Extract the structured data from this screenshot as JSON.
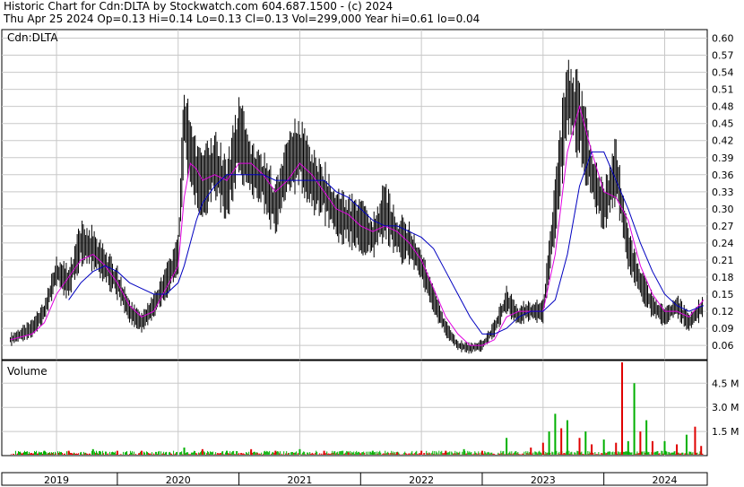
{
  "header": {
    "line1": "Historic Chart for Cdn:DLTA by Stockwatch.com 604.687.1500 - (c) 2024",
    "line2": "Thu Apr 25 2024   Op=0.13  Hi=0.14  Lo=0.13  Cl=0.13  Vol=299,000  Year hi=0.61  lo=0.04"
  },
  "chart_data": [
    {
      "type": "line",
      "title": "Cdn:DLTA",
      "x_labels": [
        "2019",
        "2020",
        "2021",
        "2022",
        "2023",
        "2024"
      ],
      "yticks": [
        "0.06",
        "0.09",
        "0.12",
        "0.15",
        "0.18",
        "0.21",
        "0.24",
        "0.27",
        "0.30",
        "0.33",
        "0.36",
        "0.39",
        "0.42",
        "0.45",
        "0.48",
        "0.51",
        "0.54",
        "0.57",
        "0.60"
      ],
      "ylim": [
        0.035,
        0.615
      ],
      "series": [
        {
          "kind": "price-hilo-bars",
          "color": "#000000",
          "x": [
            2018.62,
            2018.8,
            2018.9,
            2019.0,
            2019.1,
            2019.2,
            2019.3,
            2019.4,
            2019.5,
            2019.6,
            2019.7,
            2019.8,
            2019.9,
            2020.0,
            2020.05,
            2020.1,
            2020.15,
            2020.2,
            2020.3,
            2020.4,
            2020.5,
            2020.6,
            2020.7,
            2020.8,
            2020.9,
            2021.0,
            2021.1,
            2021.2,
            2021.3,
            2021.4,
            2021.5,
            2021.6,
            2021.7,
            2021.8,
            2021.9,
            2022.0,
            2022.1,
            2022.2,
            2022.3,
            2022.4,
            2022.5,
            2022.6,
            2022.7,
            2022.8,
            2022.85,
            2022.9,
            2023.0,
            2023.1,
            2023.2,
            2023.3,
            2023.4,
            2023.5,
            2023.6,
            2023.7,
            2023.8,
            2023.9,
            2024.0,
            2024.1,
            2024.2,
            2024.32
          ],
          "values": [
            0.07,
            0.09,
            0.12,
            0.19,
            0.17,
            0.24,
            0.23,
            0.2,
            0.17,
            0.12,
            0.1,
            0.13,
            0.17,
            0.22,
            0.46,
            0.4,
            0.36,
            0.34,
            0.38,
            0.33,
            0.43,
            0.37,
            0.35,
            0.3,
            0.38,
            0.4,
            0.35,
            0.33,
            0.29,
            0.28,
            0.27,
            0.25,
            0.3,
            0.25,
            0.24,
            0.2,
            0.14,
            0.09,
            0.06,
            0.055,
            0.06,
            0.09,
            0.14,
            0.11,
            0.12,
            0.12,
            0.12,
            0.3,
            0.5,
            0.46,
            0.36,
            0.3,
            0.37,
            0.23,
            0.17,
            0.13,
            0.11,
            0.13,
            0.1,
            0.13
          ]
        },
        {
          "kind": "moving-average-short",
          "color": "#e000e0",
          "x": [
            2018.62,
            2018.8,
            2018.9,
            2019.0,
            2019.1,
            2019.2,
            2019.3,
            2019.4,
            2019.5,
            2019.6,
            2019.7,
            2019.8,
            2019.9,
            2020.0,
            2020.05,
            2020.1,
            2020.15,
            2020.2,
            2020.3,
            2020.4,
            2020.5,
            2020.6,
            2020.7,
            2020.8,
            2020.9,
            2021.0,
            2021.1,
            2021.2,
            2021.3,
            2021.4,
            2021.5,
            2021.6,
            2021.7,
            2021.8,
            2021.9,
            2022.0,
            2022.1,
            2022.2,
            2022.3,
            2022.4,
            2022.5,
            2022.6,
            2022.7,
            2022.8,
            2022.85,
            2022.9,
            2023.0,
            2023.1,
            2023.2,
            2023.3,
            2023.4,
            2023.5,
            2023.6,
            2023.7,
            2023.8,
            2023.9,
            2024.0,
            2024.1,
            2024.2,
            2024.32
          ],
          "values": [
            0.07,
            0.08,
            0.1,
            0.15,
            0.18,
            0.21,
            0.22,
            0.2,
            0.17,
            0.13,
            0.11,
            0.12,
            0.16,
            0.2,
            0.32,
            0.38,
            0.37,
            0.35,
            0.36,
            0.35,
            0.38,
            0.38,
            0.36,
            0.33,
            0.35,
            0.38,
            0.36,
            0.33,
            0.3,
            0.29,
            0.27,
            0.26,
            0.27,
            0.26,
            0.24,
            0.21,
            0.16,
            0.11,
            0.08,
            0.06,
            0.06,
            0.07,
            0.11,
            0.12,
            0.12,
            0.12,
            0.12,
            0.22,
            0.4,
            0.48,
            0.4,
            0.33,
            0.32,
            0.28,
            0.2,
            0.15,
            0.12,
            0.12,
            0.11,
            0.14
          ]
        },
        {
          "kind": "moving-average-long",
          "color": "#0000c0",
          "x": [
            2018.62,
            2018.8,
            2018.9,
            2019.0,
            2019.1,
            2019.2,
            2019.3,
            2019.4,
            2019.5,
            2019.6,
            2019.7,
            2019.8,
            2019.9,
            2020.0,
            2020.05,
            2020.1,
            2020.15,
            2020.2,
            2020.3,
            2020.4,
            2020.5,
            2020.6,
            2020.7,
            2020.8,
            2020.9,
            2021.0,
            2021.1,
            2021.2,
            2021.3,
            2021.4,
            2021.5,
            2021.6,
            2021.7,
            2021.8,
            2021.9,
            2022.0,
            2022.1,
            2022.2,
            2022.3,
            2022.4,
            2022.5,
            2022.6,
            2022.7,
            2022.8,
            2022.85,
            2022.9,
            2023.0,
            2023.1,
            2023.2,
            2023.3,
            2023.4,
            2023.5,
            2023.6,
            2023.7,
            2023.8,
            2023.9,
            2024.0,
            2024.1,
            2024.2,
            2024.32
          ],
          "values": [
            null,
            null,
            null,
            null,
            0.14,
            0.17,
            0.19,
            0.2,
            0.19,
            0.17,
            0.16,
            0.15,
            0.15,
            0.17,
            0.2,
            0.24,
            0.28,
            0.31,
            0.34,
            0.36,
            0.36,
            0.36,
            0.36,
            0.35,
            0.35,
            0.35,
            0.35,
            0.35,
            0.33,
            0.32,
            0.3,
            0.28,
            0.27,
            0.27,
            0.26,
            0.25,
            0.23,
            0.19,
            0.15,
            0.11,
            0.08,
            0.08,
            0.09,
            0.11,
            0.115,
            0.12,
            0.12,
            0.14,
            0.22,
            0.34,
            0.4,
            0.4,
            0.35,
            0.3,
            0.24,
            0.19,
            0.15,
            0.13,
            0.12,
            0.13
          ]
        }
      ]
    },
    {
      "type": "bar",
      "title": "Volume",
      "x_labels": [
        "2019",
        "2020",
        "2021",
        "2022",
        "2023",
        "2024"
      ],
      "yticks": [
        "1.5 M",
        "3.0 M",
        "4.5 M"
      ],
      "ylim": [
        0,
        5.8
      ],
      "unit": "M",
      "up_color": "#00b000",
      "down_color": "#e00000",
      "x": [
        2018.7,
        2018.9,
        2019.1,
        2019.3,
        2019.5,
        2019.7,
        2019.9,
        2020.05,
        2020.2,
        2020.4,
        2020.6,
        2020.8,
        2021.0,
        2021.2,
        2021.4,
        2021.6,
        2021.8,
        2022.0,
        2022.2,
        2022.35,
        2022.5,
        2022.7,
        2022.9,
        2023.0,
        2023.05,
        2023.1,
        2023.15,
        2023.2,
        2023.3,
        2023.35,
        2023.4,
        2023.5,
        2023.6,
        2023.65,
        2023.7,
        2023.75,
        2023.8,
        2023.85,
        2023.9,
        2024.0,
        2024.1,
        2024.18,
        2024.25,
        2024.3
      ],
      "values": [
        0.2,
        0.3,
        0.3,
        0.4,
        0.3,
        0.3,
        0.2,
        0.5,
        0.4,
        0.3,
        0.4,
        0.3,
        0.4,
        0.3,
        0.2,
        0.3,
        0.2,
        0.3,
        0.3,
        0.4,
        0.3,
        1.1,
        0.5,
        0.8,
        1.5,
        2.6,
        1.7,
        2.2,
        1.1,
        1.5,
        0.7,
        1.0,
        0.8,
        5.8,
        0.9,
        4.5,
        1.5,
        2.2,
        0.9,
        0.9,
        0.7,
        1.3,
        1.8,
        0.6
      ],
      "direction": [
        "up",
        "up",
        "down",
        "up",
        "down",
        "down",
        "up",
        "up",
        "down",
        "up",
        "down",
        "down",
        "up",
        "down",
        "down",
        "up",
        "down",
        "down",
        "down",
        "up",
        "down",
        "up",
        "down",
        "down",
        "up",
        "up",
        "down",
        "up",
        "down",
        "up",
        "down",
        "up",
        "down",
        "down",
        "up",
        "up",
        "down",
        "up",
        "down",
        "up",
        "down",
        "up",
        "down",
        "down"
      ]
    }
  ]
}
